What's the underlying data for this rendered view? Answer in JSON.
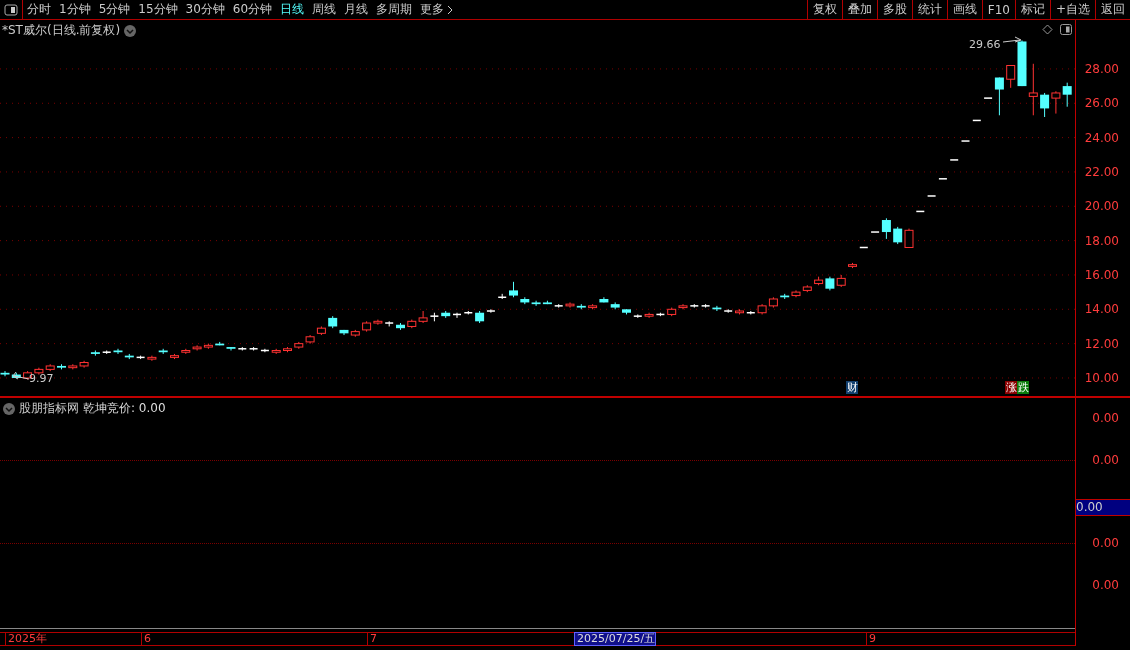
{
  "toolbar": {
    "periods": [
      {
        "label": "分时",
        "selected": false
      },
      {
        "label": "1分钟",
        "selected": false
      },
      {
        "label": "5分钟",
        "selected": false
      },
      {
        "label": "15分钟",
        "selected": false
      },
      {
        "label": "30分钟",
        "selected": false
      },
      {
        "label": "60分钟",
        "selected": false
      },
      {
        "label": "日线",
        "selected": true
      },
      {
        "label": "周线",
        "selected": false
      },
      {
        "label": "月线",
        "selected": false
      },
      {
        "label": "多周期",
        "selected": false
      }
    ],
    "more": "更多",
    "buttons": [
      "复权",
      "叠加",
      "多股",
      "统计",
      "画线",
      "F10",
      "标记",
      "+自选",
      "返回"
    ]
  },
  "chart": {
    "title": "*ST威尔(日线.前复权)",
    "high_label": "29.66",
    "low_label": "9.97",
    "event_markers": [
      {
        "label": "财",
        "color": "#123f6e"
      },
      {
        "label": "涨",
        "color": "#8a0000"
      },
      {
        "label": "跌",
        "color": "#0a7a0a"
      }
    ],
    "chart_data": {
      "type": "candlestick",
      "ylim": [
        8.95,
        30.85
      ],
      "grid": true,
      "yticks": [
        {
          "value": 28,
          "label": "28.00"
        },
        {
          "value": 26,
          "label": "26.00"
        },
        {
          "value": 24,
          "label": "24.00"
        },
        {
          "value": 22,
          "label": "22.00"
        },
        {
          "value": 20,
          "label": "20.00"
        },
        {
          "value": 18,
          "label": "18.00"
        },
        {
          "value": 16,
          "label": "16.00"
        },
        {
          "value": 14,
          "label": "14.00"
        },
        {
          "value": 12,
          "label": "12.00"
        },
        {
          "value": 10,
          "label": "10.00"
        }
      ],
      "ohlc": [
        [
          10.3,
          10.4,
          10.1,
          10.2
        ],
        [
          10.2,
          10.3,
          9.97,
          10.0
        ],
        [
          10.0,
          10.4,
          9.9,
          10.3
        ],
        [
          10.3,
          10.6,
          10.2,
          10.5
        ],
        [
          10.5,
          10.8,
          10.4,
          10.7
        ],
        [
          10.7,
          10.8,
          10.5,
          10.6
        ],
        [
          10.6,
          10.8,
          10.5,
          10.7
        ],
        [
          10.7,
          11.0,
          10.6,
          10.9
        ],
        [
          11.5,
          11.6,
          11.3,
          11.4
        ],
        [
          11.5,
          11.6,
          11.4,
          11.5
        ],
        [
          11.6,
          11.7,
          11.4,
          11.5
        ],
        [
          11.3,
          11.4,
          11.1,
          11.2
        ],
        [
          11.2,
          11.3,
          11.1,
          11.2
        ],
        [
          11.1,
          11.3,
          11.0,
          11.2
        ],
        [
          11.6,
          11.7,
          11.4,
          11.5
        ],
        [
          11.2,
          11.4,
          11.1,
          11.3
        ],
        [
          11.5,
          11.7,
          11.4,
          11.6
        ],
        [
          11.7,
          11.9,
          11.6,
          11.8
        ],
        [
          11.8,
          12.0,
          11.7,
          11.9
        ],
        [
          12.0,
          12.1,
          11.9,
          11.9
        ],
        [
          11.8,
          11.8,
          11.6,
          11.7
        ],
        [
          11.7,
          11.8,
          11.6,
          11.7
        ],
        [
          11.7,
          11.8,
          11.6,
          11.7
        ],
        [
          11.6,
          11.7,
          11.5,
          11.6
        ],
        [
          11.5,
          11.7,
          11.4,
          11.6
        ],
        [
          11.6,
          11.8,
          11.5,
          11.7
        ],
        [
          11.8,
          12.1,
          11.7,
          12.0
        ],
        [
          12.1,
          12.5,
          12.0,
          12.4
        ],
        [
          12.6,
          13.0,
          12.5,
          12.9
        ],
        [
          13.5,
          13.6,
          12.9,
          13.0
        ],
        [
          12.8,
          12.8,
          12.5,
          12.6
        ],
        [
          12.5,
          12.8,
          12.4,
          12.7
        ],
        [
          12.8,
          13.3,
          12.7,
          13.2
        ],
        [
          13.2,
          13.4,
          13.1,
          13.3
        ],
        [
          13.2,
          13.3,
          13.0,
          13.2
        ],
        [
          13.1,
          13.2,
          12.8,
          12.9
        ],
        [
          13.0,
          13.4,
          12.9,
          13.3
        ],
        [
          13.3,
          13.9,
          13.2,
          13.5
        ],
        [
          13.6,
          13.8,
          13.3,
          13.6
        ],
        [
          13.8,
          13.9,
          13.5,
          13.6
        ],
        [
          13.7,
          13.8,
          13.5,
          13.7
        ],
        [
          13.8,
          13.9,
          13.7,
          13.8
        ],
        [
          13.8,
          13.9,
          13.2,
          13.3
        ],
        [
          13.9,
          14.0,
          13.8,
          13.9
        ],
        [
          14.7,
          14.9,
          14.6,
          14.7
        ],
        [
          15.1,
          15.6,
          14.7,
          14.8
        ],
        [
          14.6,
          14.7,
          14.3,
          14.4
        ],
        [
          14.4,
          14.5,
          14.2,
          14.3
        ],
        [
          14.4,
          14.5,
          14.3,
          14.3
        ],
        [
          14.2,
          14.3,
          14.1,
          14.2
        ],
        [
          14.2,
          14.4,
          14.1,
          14.3
        ],
        [
          14.2,
          14.3,
          14.0,
          14.1
        ],
        [
          14.1,
          14.3,
          14.0,
          14.2
        ],
        [
          14.6,
          14.7,
          14.4,
          14.4
        ],
        [
          14.3,
          14.4,
          14.0,
          14.1
        ],
        [
          14.0,
          14.0,
          13.7,
          13.8
        ],
        [
          13.6,
          13.7,
          13.5,
          13.6
        ],
        [
          13.6,
          13.8,
          13.5,
          13.7
        ],
        [
          13.7,
          13.8,
          13.6,
          13.7
        ],
        [
          13.7,
          14.1,
          13.6,
          14.0
        ],
        [
          14.1,
          14.3,
          14.0,
          14.2
        ],
        [
          14.2,
          14.3,
          14.1,
          14.2
        ],
        [
          14.2,
          14.3,
          14.1,
          14.2
        ],
        [
          14.1,
          14.2,
          13.9,
          14.0
        ],
        [
          13.9,
          14.0,
          13.8,
          13.9
        ],
        [
          13.8,
          14.0,
          13.7,
          13.9
        ],
        [
          13.8,
          13.9,
          13.7,
          13.8
        ],
        [
          13.8,
          14.3,
          13.7,
          14.2
        ],
        [
          14.2,
          14.7,
          14.1,
          14.6
        ],
        [
          14.8,
          14.9,
          14.6,
          14.7
        ],
        [
          14.8,
          15.1,
          14.7,
          15.0
        ],
        [
          15.1,
          15.4,
          15.0,
          15.3
        ],
        [
          15.5,
          15.9,
          15.4,
          15.7
        ],
        [
          15.8,
          15.9,
          15.1,
          15.2
        ],
        [
          15.4,
          16.0,
          15.3,
          15.8
        ],
        [
          16.5,
          16.7,
          16.4,
          16.6
        ],
        [
          17.6,
          17.6,
          17.6,
          17.6
        ],
        [
          18.5,
          18.5,
          18.5,
          18.5
        ],
        [
          19.2,
          19.3,
          18.1,
          18.5
        ],
        [
          18.7,
          18.8,
          17.8,
          17.9
        ],
        [
          17.6,
          18.7,
          17.6,
          18.6
        ],
        [
          19.7,
          19.7,
          19.7,
          19.7
        ],
        [
          20.6,
          20.6,
          20.6,
          20.6
        ],
        [
          21.6,
          21.6,
          21.6,
          21.6
        ],
        [
          22.7,
          22.7,
          22.7,
          22.7
        ],
        [
          23.8,
          23.8,
          23.8,
          23.8
        ],
        [
          25.0,
          25.0,
          25.0,
          25.0
        ],
        [
          26.3,
          26.3,
          26.3,
          26.3
        ],
        [
          27.5,
          27.5,
          25.3,
          26.8
        ],
        [
          27.4,
          28.2,
          26.9,
          28.2
        ],
        [
          29.6,
          29.66,
          27.0,
          27.0
        ],
        [
          26.4,
          28.3,
          25.3,
          26.6
        ],
        [
          26.5,
          26.6,
          25.2,
          25.7
        ],
        [
          26.3,
          26.7,
          25.4,
          26.6
        ],
        [
          27.0,
          27.2,
          25.8,
          26.5
        ]
      ]
    }
  },
  "indicator": {
    "source": "股朋指标网",
    "name": "乾坤竞价: 0.00",
    "axis_labels": [
      "0.00",
      "0.00",
      "0.00",
      "0.00"
    ],
    "value_box": "0.00"
  },
  "date_bar": [
    {
      "label": "2025年",
      "selected": false
    },
    {
      "label": "6",
      "selected": false
    },
    {
      "label": "7",
      "selected": false
    },
    {
      "label": "2025/07/25/五",
      "selected": true
    },
    {
      "label": "9",
      "selected": false
    }
  ]
}
